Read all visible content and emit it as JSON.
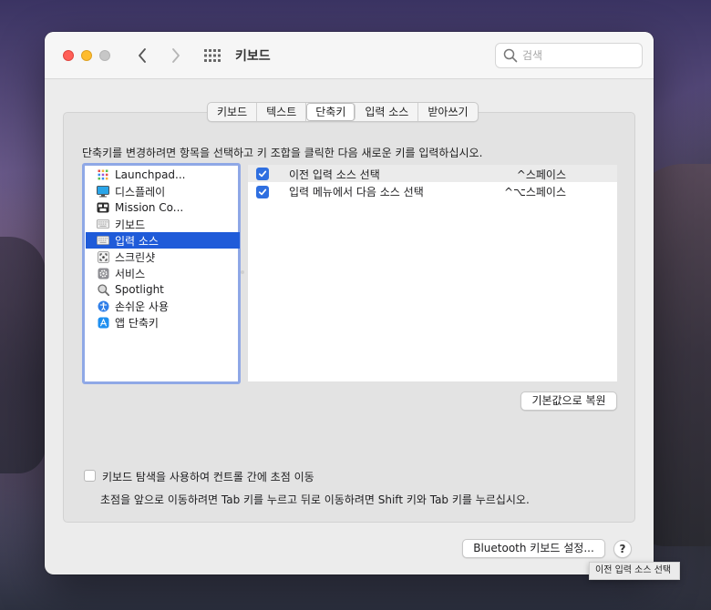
{
  "window": {
    "title": "키보드"
  },
  "search": {
    "placeholder": "검색"
  },
  "tabs": [
    {
      "label": "키보드"
    },
    {
      "label": "텍스트"
    },
    {
      "label": "단축키"
    },
    {
      "label": "입력 소스"
    },
    {
      "label": "받아쓰기"
    }
  ],
  "selected_tab": "단축키",
  "instruction": "단축키를 변경하려면 항목을 선택하고 키 조합을 클릭한 다음 새로운 키를 입력하십시오.",
  "categories": [
    {
      "label": "Launchpad...",
      "icon": "launchpad-icon"
    },
    {
      "label": "디스플레이",
      "icon": "display-icon"
    },
    {
      "label": "Mission Co...",
      "icon": "mission-control-icon"
    },
    {
      "label": "키보드",
      "icon": "keyboard-icon"
    },
    {
      "label": "입력 소스",
      "icon": "keyboard-icon",
      "selected": true
    },
    {
      "label": "스크린샷",
      "icon": "screenshot-icon"
    },
    {
      "label": "서비스",
      "icon": "gear-icon"
    },
    {
      "label": "Spotlight",
      "icon": "spotlight-icon"
    },
    {
      "label": "손쉬운 사용",
      "icon": "accessibility-icon"
    },
    {
      "label": "앱 단축키",
      "icon": "app-store-icon"
    }
  ],
  "shortcuts": [
    {
      "checked": true,
      "name": "이전 입력 소스 선택",
      "keys": "^스페이스"
    },
    {
      "checked": true,
      "name": "입력 메뉴에서 다음 소스 선택",
      "keys": "^⌥스페이스"
    }
  ],
  "restore_button": "기본값으로 복원",
  "keyboard_navigation": {
    "checked": false,
    "label": "키보드 탐색을 사용하여 컨트롤 간에 초점 이동",
    "description": "초점을 앞으로 이동하려면 Tab 키를 누르고 뒤로 이동하려면 Shift 키와 Tab 키를 누르십시오."
  },
  "bluetooth_button": "Bluetooth 키보드 설정...",
  "help_button": "?",
  "tooltip": "이전 입력 소스 선택",
  "colors": {
    "accent": "#1f5bd9",
    "checkbox": "#2f6fe0",
    "close": "#ff5f57",
    "minimize": "#febc2e"
  }
}
